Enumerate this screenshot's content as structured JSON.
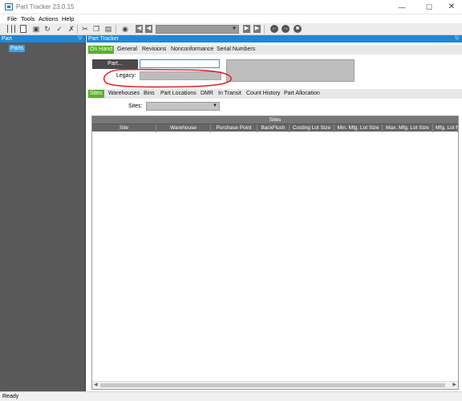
{
  "window": {
    "title": "Part Tracker 23.0.15"
  },
  "menu": [
    "File",
    "Tools",
    "Actions",
    "Help"
  ],
  "left_panel": {
    "title": "Part",
    "tree_item": "Parts"
  },
  "main_panel": {
    "title": "Part Tracker"
  },
  "top_tabs": [
    "On Hand",
    "General",
    "Revisions",
    "Nonconformance",
    "Serial Numbers"
  ],
  "part": {
    "button_label": "Part...",
    "value": "",
    "legacy_label": "Legacy:",
    "legacy_value": ""
  },
  "sub_tabs": [
    "Sites",
    "Warehouses",
    "Bins",
    "Part Locations",
    "DMR",
    "In Transit",
    "Count History",
    "Part Allocation"
  ],
  "sites_filter": {
    "label": "Sites:",
    "value": ""
  },
  "grid": {
    "caption": "Sites",
    "columns": [
      "Site",
      "Warehouse",
      "Purchase Point",
      "BackFlush",
      "Costing Lot Size",
      "Min. Mfg. Lot Size",
      "Max. Mfg. Lot Size",
      "Mfg. Lot M"
    ]
  },
  "status": "Ready",
  "colors": {
    "accent_blue": "#1e88d8",
    "active_tab_green": "#58b228",
    "annotation_red": "#e0262a"
  }
}
